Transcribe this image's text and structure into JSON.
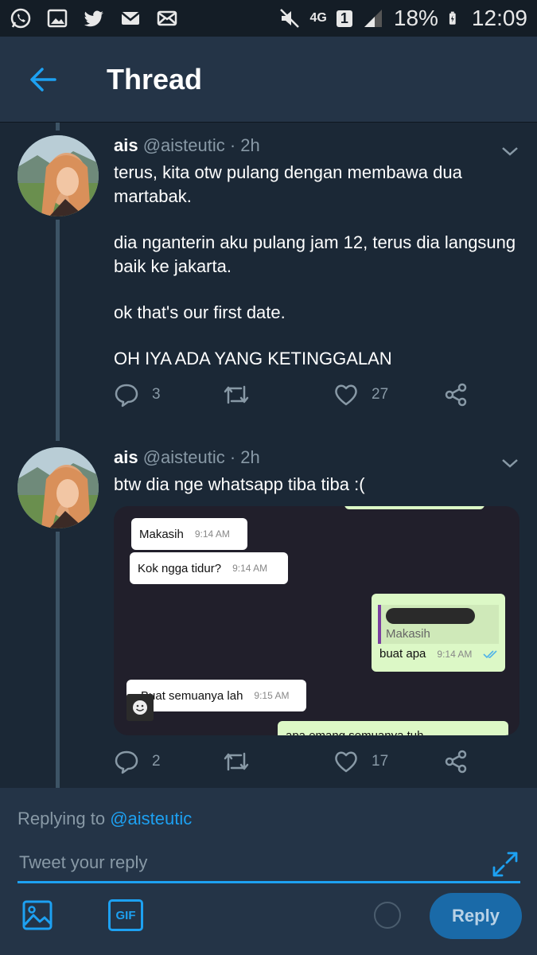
{
  "status_bar": {
    "network": "4G",
    "sim": "1",
    "battery": "18%",
    "time": "12:09",
    "left_icons": [
      "whatsapp-icon",
      "gallery-icon",
      "twitter-icon",
      "gmail-icon",
      "mail-icon"
    ]
  },
  "header": {
    "title": "Thread"
  },
  "tweets": [
    {
      "name": "ais",
      "handle": "@aisteutic · 2h",
      "paragraphs": [
        "terus, kita otw pulang dengan membawa dua martabak.",
        "dia nganterin aku pulang jam 12, terus dia langsung baik ke jakarta.",
        "ok that's our first date.",
        "OH IYA ADA YANG KETINGGALAN"
      ],
      "replies": "3",
      "retweets": "",
      "likes": "27"
    },
    {
      "name": "ais",
      "handle": "@aisteutic · 2h",
      "paragraphs": [
        "btw dia nge whatsapp tiba tiba :("
      ],
      "replies": "2",
      "retweets": "",
      "likes": "17",
      "whatsapp": {
        "messages": [
          {
            "text": "Makasih",
            "time": "9:14 AM",
            "dir": "in"
          },
          {
            "text": "Kok ngga tidur?",
            "time": "9:14 AM",
            "dir": "in"
          },
          {
            "quote": "Makasih",
            "text": "buat apa",
            "time": "9:14 AM",
            "dir": "out"
          },
          {
            "text": "Buat semuanya lah",
            "time": "9:15 AM",
            "dir": "in"
          },
          {
            "text": "apa emang semuanya tuh",
            "time": "",
            "dir": "out"
          }
        ]
      }
    }
  ],
  "composer": {
    "replying_prefix": "Replying to",
    "replying_handle": "@aisteutic",
    "placeholder": "Tweet your reply",
    "gif_label": "GIF",
    "reply_label": "Reply"
  },
  "colors": {
    "accent": "#1da1f2",
    "background": "#1b2836",
    "header": "#243447",
    "muted": "#8899a6"
  }
}
